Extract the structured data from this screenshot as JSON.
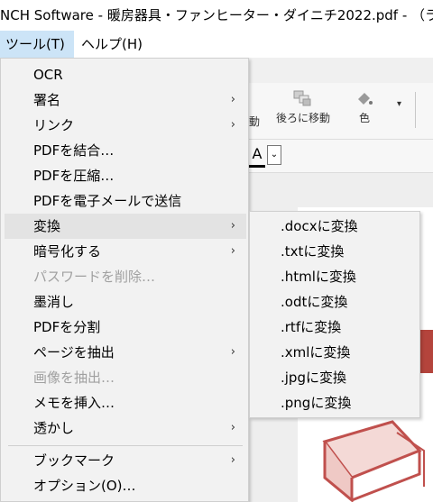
{
  "window": {
    "title": "NCH Software - 暖房器具・ファンヒーター・ダイニチ2022.pdf - （ラ"
  },
  "menubar": {
    "tools": "ツール(T)",
    "help": "ヘルプ(H)"
  },
  "toolbar": {
    "move_label_partial": "動",
    "move_back_label": "後ろに移動",
    "color_label": "色"
  },
  "format": {
    "font_letter": "A",
    "dropdown": "⌄"
  },
  "tools_menu": {
    "items": [
      {
        "label": "OCR",
        "arrow": ""
      },
      {
        "label": "署名",
        "arrow": "›"
      },
      {
        "label": "リンク",
        "arrow": "›"
      },
      {
        "label": "PDFを結合…",
        "arrow": ""
      },
      {
        "label": "PDFを圧縮…",
        "arrow": ""
      },
      {
        "label": "PDFを電子メールで送信",
        "arrow": ""
      },
      {
        "label": "変換",
        "arrow": "›"
      },
      {
        "label": "暗号化する",
        "arrow": "›"
      },
      {
        "label": "パスワードを削除…",
        "arrow": ""
      },
      {
        "label": "墨消し",
        "arrow": ""
      },
      {
        "label": "PDFを分割",
        "arrow": ""
      },
      {
        "label": "ページを抽出",
        "arrow": "›"
      },
      {
        "label": "画像を抽出…",
        "arrow": ""
      },
      {
        "label": "メモを挿入…",
        "arrow": ""
      },
      {
        "label": "透かし",
        "arrow": "›"
      },
      {
        "label": "ブックマーク",
        "arrow": "›"
      },
      {
        "label": "オプション(O)…",
        "arrow": ""
      }
    ]
  },
  "convert_submenu": {
    "items": [
      ".docxに変換",
      ".txtに変換",
      ".htmlに変換",
      ".odtに変換",
      ".rtfに変換",
      ".xmlに変換",
      ".jpgに変換",
      ".pngに変換"
    ]
  }
}
